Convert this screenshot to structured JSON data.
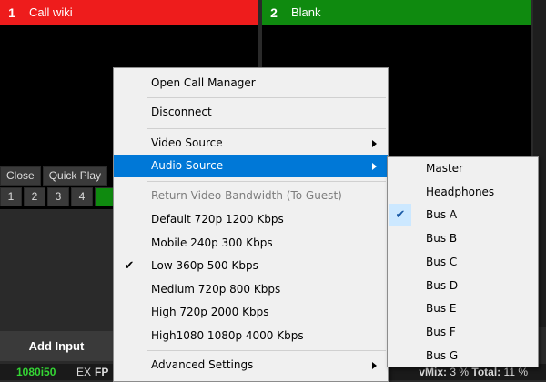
{
  "inputs": [
    {
      "number": "1",
      "title": "Call wiki",
      "color": "#ee1c1c"
    },
    {
      "number": "2",
      "title": "Blank",
      "color": "#0f8a0f"
    }
  ],
  "toolbar": {
    "close_label": "Close",
    "quick_play_label": "Quick Play",
    "numbers": [
      "1",
      "2",
      "3",
      "4"
    ]
  },
  "add_input_label": "Add Input",
  "status": {
    "resolution": "1080i50",
    "ex": "EX",
    "fps": "FP",
    "cpu_label": "vMix:",
    "cpu_value": "3 %",
    "total_label": "Total:",
    "total_value": "11 %"
  },
  "menu": {
    "open_call_manager": "Open Call Manager",
    "disconnect": "Disconnect",
    "video_source": "Video Source",
    "audio_source": "Audio Source",
    "bandwidth_header": "Return Video Bandwidth (To Guest)",
    "bandwidth_options": [
      {
        "label": "Default 720p 1200 Kbps",
        "checked": false
      },
      {
        "label": "Mobile 240p 300 Kbps",
        "checked": false
      },
      {
        "label": "Low 360p 500 Kbps",
        "checked": true
      },
      {
        "label": "Medium 720p 800 Kbps",
        "checked": false
      },
      {
        "label": "High 720p 2000 Kbps",
        "checked": false
      },
      {
        "label": "High1080 1080p 4000 Kbps",
        "checked": false
      }
    ],
    "advanced_settings": "Advanced Settings"
  },
  "audio_source_menu": [
    {
      "label": "Master",
      "checked": false
    },
    {
      "label": "Headphones",
      "checked": false
    },
    {
      "label": "Bus A",
      "checked": true
    },
    {
      "label": "Bus B",
      "checked": false
    },
    {
      "label": "Bus C",
      "checked": false
    },
    {
      "label": "Bus D",
      "checked": false
    },
    {
      "label": "Bus E",
      "checked": false
    },
    {
      "label": "Bus F",
      "checked": false
    },
    {
      "label": "Bus G",
      "checked": false
    }
  ],
  "colors": {
    "highlight": "#0078d7",
    "status_green": "#34d534"
  }
}
